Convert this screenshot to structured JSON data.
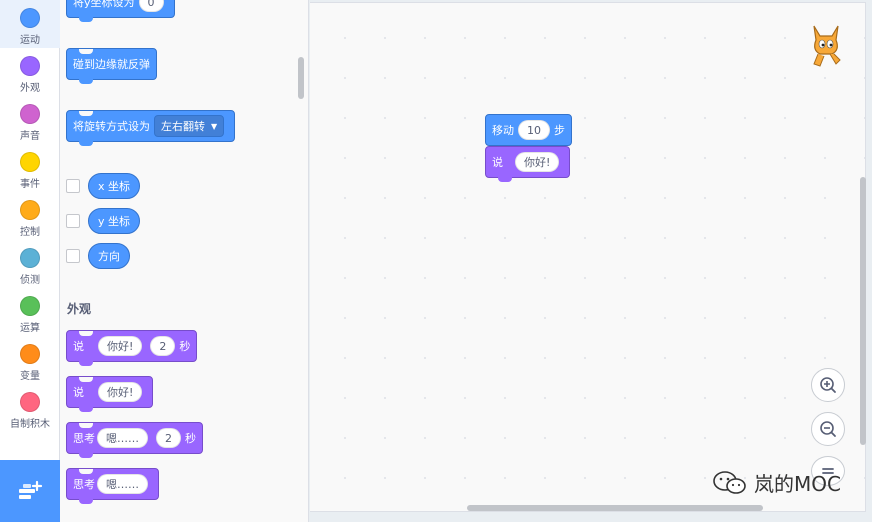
{
  "categories": [
    {
      "label": "运动",
      "color": "#4c97ff",
      "selected": true
    },
    {
      "label": "外观",
      "color": "#9966ff"
    },
    {
      "label": "声音",
      "color": "#cf63cf"
    },
    {
      "label": "事件",
      "color": "#ffd500"
    },
    {
      "label": "控制",
      "color": "#ffab19"
    },
    {
      "label": "侦测",
      "color": "#5cb1d6"
    },
    {
      "label": "运算",
      "color": "#59c059"
    },
    {
      "label": "变量",
      "color": "#ff8c1a"
    },
    {
      "label": "自制积木",
      "color": "#ff6680"
    }
  ],
  "extension_icon": "add-extension-icon",
  "palette": {
    "set_y": {
      "label": "将y坐标设为",
      "value": "0"
    },
    "bounce": {
      "label": "碰到边缘就反弹"
    },
    "rotation": {
      "label": "将旋转方式设为",
      "option": "左右翻转"
    },
    "reporters": [
      "x 坐标",
      "y 坐标",
      "方向"
    ],
    "looks_title": "外观",
    "say_for": {
      "label": "说",
      "text": "你好!",
      "secs": "2",
      "unit": "秒"
    },
    "say": {
      "label": "说",
      "text": "你好!"
    },
    "think_for": {
      "label": "思考",
      "text": "嗯……",
      "secs": "2",
      "unit": "秒"
    },
    "think": {
      "label": "思考",
      "text": "嗯……"
    }
  },
  "workspace": {
    "move": {
      "label": "移动",
      "value": "10",
      "unit": "步"
    },
    "say": {
      "label": "说",
      "text": "你好!"
    }
  },
  "watermark": "岚的MOC",
  "colors": {
    "motion": "#4c97ff",
    "looks": "#9966ff",
    "accent": "#4c97ff"
  }
}
